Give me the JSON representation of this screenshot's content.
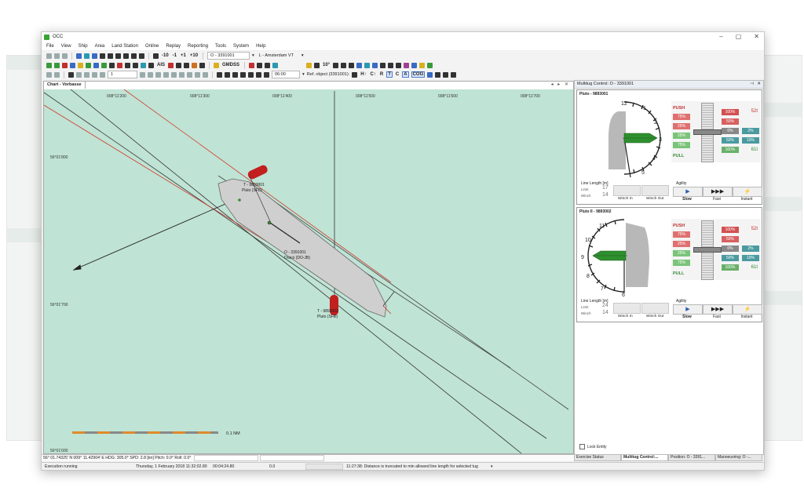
{
  "window": {
    "app_title": "OCC",
    "min_glyph": "–",
    "max_glyph": "▢",
    "close_glyph": "✕"
  },
  "menu": [
    "File",
    "View",
    "Ship",
    "Area",
    "Land Station",
    "Online",
    "Replay",
    "Reporting",
    "Tools",
    "System",
    "Help"
  ],
  "toolbar": {
    "time_steps": [
      "-10",
      "-1",
      "+1",
      "+10"
    ],
    "own_ship_select": "O - 3391001",
    "route_select": "L - Amsterdam VT",
    "ais_label": "AIS",
    "gmdss_label": "GMDSS",
    "ten_deg_label": "10°",
    "time_select": "06:00",
    "step_select": "1",
    "ref_object_label": "Ref. object (3391001):",
    "mode_buttons": [
      "H↑",
      "C↑",
      "R",
      "T",
      "C",
      "A",
      "COG"
    ]
  },
  "chart": {
    "tab": "Chart - Vorbasse",
    "nav": "◂ ▸ ✕",
    "lon_labels": [
      "008°11'200",
      "008°11'300",
      "008°11'400",
      "008°11'500",
      "008°11'600",
      "008°11'700"
    ],
    "lat_labels": [
      "56°01'800",
      "56°01'700",
      "56°01'600"
    ],
    "own_ship_id": "O - 3391001",
    "own_ship_name": "Draco (DO-JB)",
    "tug1_id": "T - 9893001",
    "tug1_name": "Pluto (SFD)",
    "tug2_id": "T - 9893002",
    "tug2_name": "Pluto (SFD)",
    "scale_label": "0.1 NM"
  },
  "status_line": "56° 01.74325' N 009° 11.42904' E  HDG: 305.0° SPD: 2.8 [kn] Pitch: 0.0° Roll: 0.0°",
  "bottom": {
    "state": "Execution running",
    "datetime": "Thursday, 1 February 2018 11:32:02.80",
    "elapsed": "00:04:24.80",
    "value": "0.0",
    "message": "11:27:38: Distance is truncated to min allowed line length for selected tug"
  },
  "multitug": {
    "title": "Multitug Control: O - 3391001",
    "pin": "⊣",
    "close": "✕",
    "push_label": "PUSH",
    "pull_label": "PULL",
    "line_length_label": "Line Length [m]",
    "line_sub_top": "Limit",
    "line_sub_bottom": "Winch",
    "winch_in": "Winch In",
    "winch_out": "Winch Out",
    "agility_label": "Agility",
    "slow": "Slow",
    "fast": "Fast",
    "instant": "Instant",
    "slow_icon": "▶",
    "fast_icon": "▶▶▶",
    "instant_icon": "⚡",
    "lock_entity": "Lock Entity",
    "tugs": [
      {
        "name": "Pluto - 9893001",
        "clock_numbers": [
          "12",
          "1",
          "2",
          "3",
          "4",
          "5"
        ],
        "push_left": [
          "75%",
          "25%"
        ],
        "pull_left": [
          "25%",
          "75%"
        ],
        "mid_values": [
          "100%",
          "50%",
          "0%",
          "50%",
          "100%"
        ],
        "right_values": [
          "2%",
          "10%"
        ],
        "push_tonnes": "52t",
        "pull_tonnes": "61t",
        "line_limit": "17",
        "line_winch": "14"
      },
      {
        "name": "Pluto II - 9893002",
        "clock_numbers": [
          "11",
          "10",
          "9",
          "8",
          "7",
          "6"
        ],
        "push_left": [
          "75%",
          "25%"
        ],
        "pull_left": [
          "25%",
          "75%"
        ],
        "mid_values": [
          "100%",
          "50%",
          "0%",
          "50%",
          "100%"
        ],
        "right_values": [
          "2%",
          "10%"
        ],
        "push_tonnes": "52t",
        "pull_tonnes": "61t",
        "line_limit": "24",
        "line_winch": "14"
      }
    ]
  },
  "bottom_tabs": [
    "Exercise Status",
    "Multitug Control:...",
    "Position: O - 3391...",
    "Manoeuvring: O -..."
  ],
  "colors": {
    "sea": "#bfe3d4",
    "hull": "#cfcfcf",
    "tug": "#c21f1f",
    "accent_blue": "#2a5db0"
  }
}
